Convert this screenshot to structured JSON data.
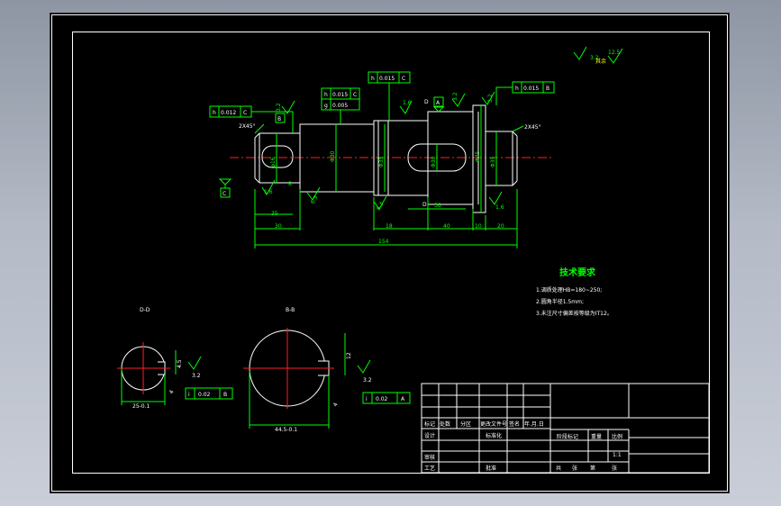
{
  "surface_roughness_note": {
    "text": "其余",
    "value": "12.5"
  },
  "tolerance_frames": [
    {
      "id": "h-0012-c",
      "symbol": "h",
      "value": "0.012",
      "datum": "C"
    },
    {
      "id": "h-0015-c",
      "symbol": "h",
      "value": "0.015",
      "datum": "C"
    },
    {
      "id": "g-0005",
      "symbol": "g",
      "value": "0.005",
      "datum": ""
    },
    {
      "id": "h-0015-c-top",
      "symbol": "h",
      "value": "0.015",
      "datum": "C"
    },
    {
      "id": "h-0015-b",
      "symbol": "h",
      "value": "0.015",
      "datum": "B"
    },
    {
      "id": "i-002-b-left",
      "symbol": "i",
      "value": "0.02",
      "datum": "B"
    },
    {
      "id": "i-002-a-right",
      "symbol": "i",
      "value": "0.02",
      "datum": "A"
    }
  ],
  "datum_labels": {
    "a": "A",
    "b": "B",
    "c": "C",
    "d": "D"
  },
  "chamfers": {
    "left": "2X45°",
    "right": "2X45°"
  },
  "diameters": {
    "d1": "φ16",
    "d2": "Φ30",
    "d3": "Φ35",
    "d4": "Φ30",
    "d5": "Φ45",
    "d6": "Φ35"
  },
  "roughness": {
    "r1": "1.6",
    "r2": "3.2",
    "r3": "6.3",
    "r4": "1.6",
    "r5": "3.2",
    "r6": "3.2",
    "r7": "6.3",
    "r8": "1.6",
    "r9": "3.2"
  },
  "dimensions": {
    "d35": "35",
    "d30": "30",
    "d8": "8",
    "d18": "18",
    "d40": "40",
    "d36": "36",
    "d10": "10",
    "d20": "20",
    "d154": "154"
  },
  "section_views": {
    "left": {
      "title": "D-D",
      "width_dim": "25-0.1",
      "key_depth": "4.5",
      "slot_dim": "4",
      "rough": "3.2"
    },
    "right": {
      "title": "B-B",
      "width_dim": "44.5-0.1",
      "key_depth": "12",
      "slot_dim": "4",
      "rough": "3.2"
    }
  },
  "technical_requirements": {
    "title": "技术要求",
    "items": [
      "1.调质处理HB=180~250;",
      "2.圆角半径1.5mm;",
      "3.未注尺寸偏差按等级为IT12。"
    ]
  },
  "title_block": {
    "header_row": [
      "标记",
      "处数",
      "分区",
      "更改文件号",
      "签名",
      "年.月.日"
    ],
    "design": "设计",
    "standardization": "标准化",
    "stage_mark": "阶段标记",
    "weight": "重量",
    "scale": "比例",
    "scale_value": "1:1",
    "review": "审核",
    "process": "工艺",
    "approve": "批准",
    "sheet_total": "共",
    "sheet_word": "张",
    "sheet_no": "第",
    "sheet_word2": "张"
  }
}
